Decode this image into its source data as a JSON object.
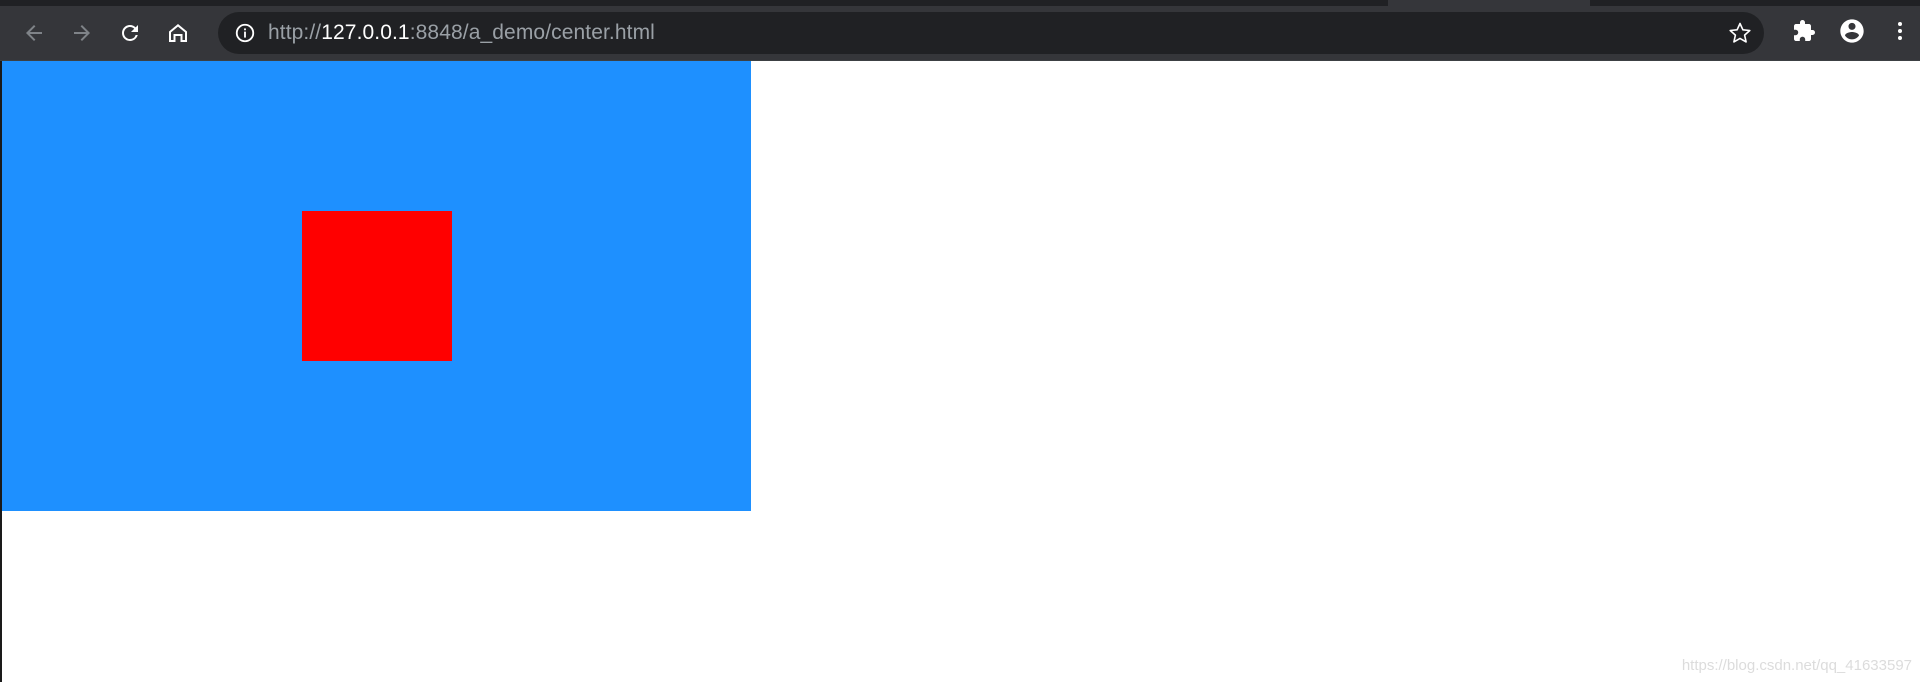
{
  "browser": {
    "url_scheme": "http://",
    "url_host": "127.0.0.1",
    "url_rest": ":8848/a_demo/center.html",
    "icons": {
      "back": "arrow-left-icon",
      "forward": "arrow-right-icon",
      "reload": "reload-icon",
      "home": "home-icon",
      "site_info": "info-icon",
      "bookmark": "star-icon",
      "extensions": "puzzle-icon",
      "profile": "account-icon",
      "menu": "kebab-menu-icon"
    },
    "colors": {
      "toolbar": "#35363a",
      "omnibox": "#202124"
    }
  },
  "page": {
    "outer_box_color": "#1e90ff",
    "inner_box_color": "#ff0000",
    "watermark": "https://blog.csdn.net/qq_41633597"
  }
}
